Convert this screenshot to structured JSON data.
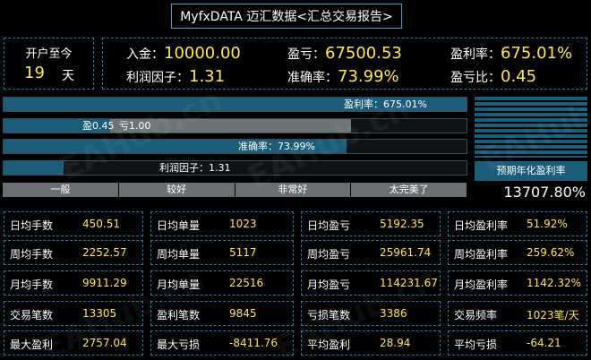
{
  "title": "MyfxDATA 迈汇数据<汇总交易报告>",
  "duration": {
    "label": "开户至今",
    "value": "19",
    "unit": "天"
  },
  "summary": {
    "deposit_label": "入金：",
    "deposit_value": "10000.00",
    "profit_label": "盈亏：",
    "profit_value": "67500.53",
    "return_label": "盈利率：",
    "return_value": "675.01%",
    "profit_factor_label": "利润因子：",
    "profit_factor_value": "1.31",
    "accuracy_label": "准确率：",
    "accuracy_value": "73.99%",
    "pl_ratio_label": "盈亏比：",
    "pl_ratio_value": "0.45"
  },
  "bars": {
    "return": {
      "text": "盈利率：675.01%",
      "fill_pct": 100
    },
    "pl": {
      "profit_text": "盈0.45",
      "loss_text": "亏1.00",
      "profit_pct": 23,
      "loss_pct": 52
    },
    "accuracy": {
      "text": "准确率：73.99%",
      "fill_pct": 73.99
    },
    "profit_factor": {
      "text": "利润因子：1.31",
      "fill_pct": 13
    }
  },
  "scale": [
    "一般",
    "较好",
    "非常好",
    "太完美了"
  ],
  "gauge": {
    "label": "预期年化盈利率",
    "value": "13707.80%"
  },
  "stats": [
    [
      {
        "k": "日均手数",
        "v": "450.51"
      },
      {
        "k": "日均单量",
        "v": "1023"
      },
      {
        "k": "日均盈亏",
        "v": "5192.35"
      },
      {
        "k": "日均盈利率",
        "v": "51.92%"
      }
    ],
    [
      {
        "k": "周均手数",
        "v": "2252.57"
      },
      {
        "k": "周均单量",
        "v": "5117"
      },
      {
        "k": "周均盈亏",
        "v": "25961.74"
      },
      {
        "k": "周均盈利率",
        "v": "259.62%"
      }
    ],
    [
      {
        "k": "月均手数",
        "v": "9911.29"
      },
      {
        "k": "月均单量",
        "v": "22516"
      },
      {
        "k": "月均盈亏",
        "v": "114231.67"
      },
      {
        "k": "月均盈利率",
        "v": "1142.32%"
      }
    ],
    [
      {
        "k": "交易笔数",
        "v": "13305"
      },
      {
        "k": "盈利笔数",
        "v": "9845"
      },
      {
        "k": "亏损笔数",
        "v": "3386"
      },
      {
        "k": "交易频率",
        "v": "1023笔/天"
      }
    ],
    [
      {
        "k": "最大盈利",
        "v": "2757.04"
      },
      {
        "k": "最大亏损",
        "v": "-8411.76"
      },
      {
        "k": "平均盈利",
        "v": "28.94"
      },
      {
        "k": "平均亏损",
        "v": "-64.21"
      }
    ]
  ],
  "watermark": "EAHub.cn",
  "colors": {
    "accent": "#ffe94a",
    "bar_fill": "#1b5c79",
    "border": "#1e7fa0"
  }
}
